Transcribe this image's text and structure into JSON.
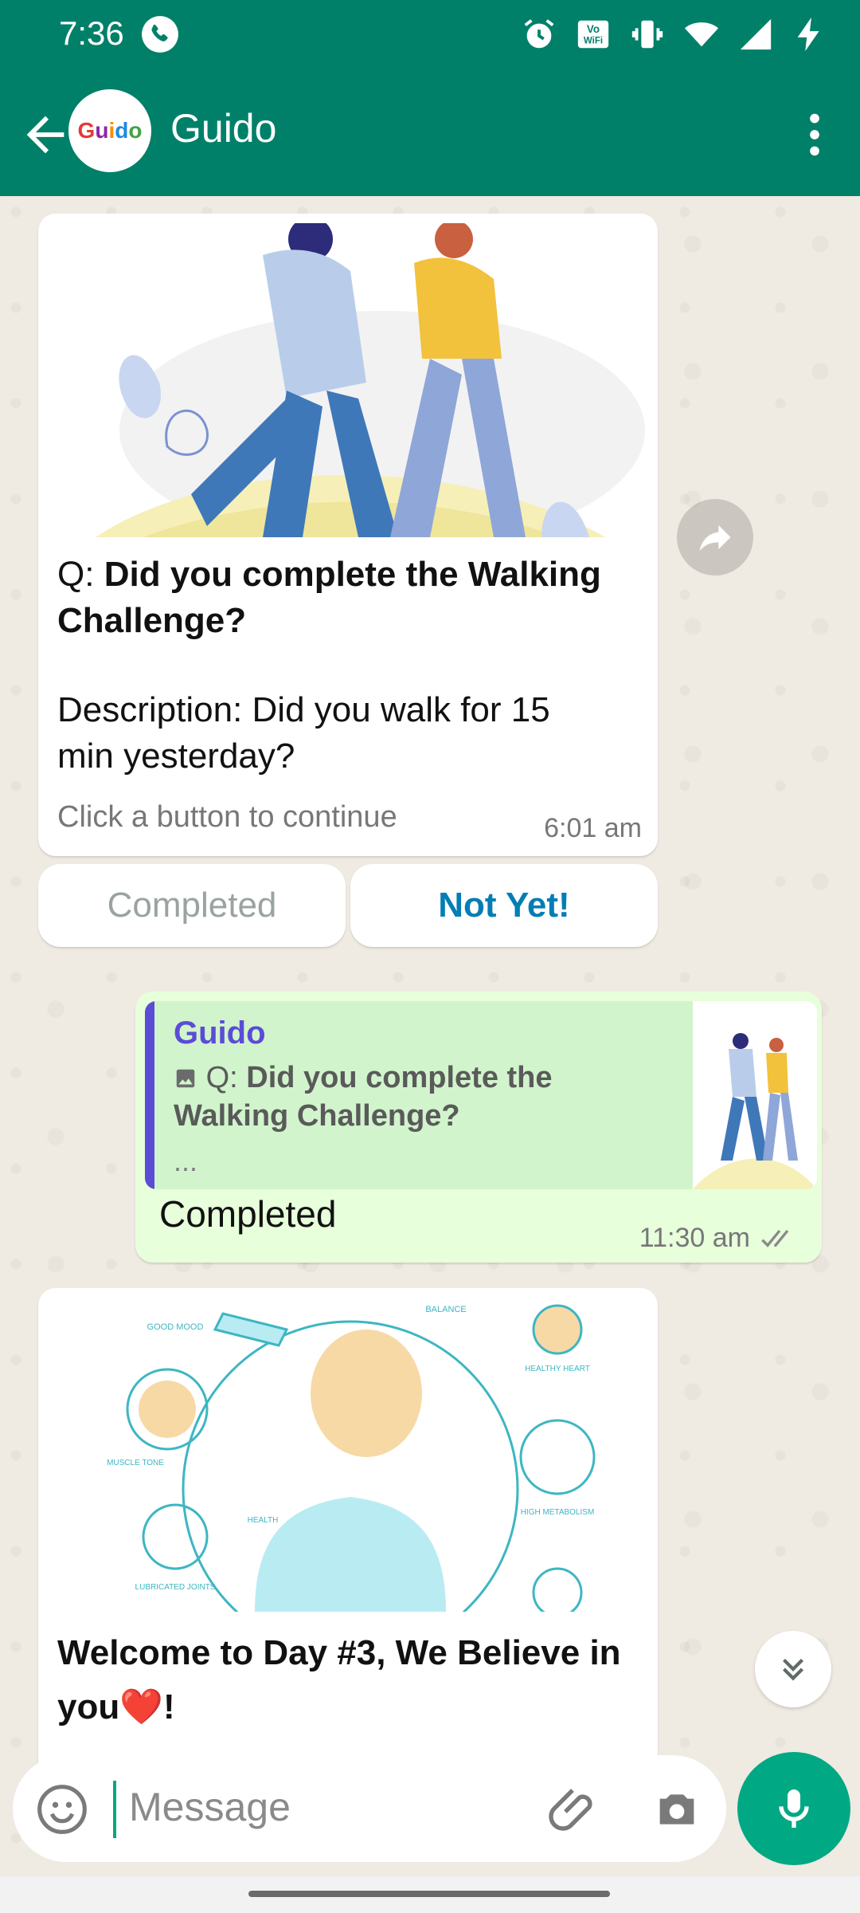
{
  "status_bar": {
    "time": "7:36",
    "icons": [
      "call-icon",
      "alarm-icon",
      "vowifi-icon",
      "vibrate-icon",
      "wifi-icon",
      "signal-icon",
      "charging-icon"
    ]
  },
  "header": {
    "avatar_text": "Guido",
    "title": "Guido"
  },
  "messages": [
    {
      "type": "incoming",
      "q_prefix": "Q: ",
      "question": "Did you complete the Walking Challenge?",
      "description": "Description: Did you walk for 15 min yesterday?",
      "hint": "Click a button to continue",
      "time": "6:01 am",
      "buttons": [
        "Completed",
        "Not Yet!"
      ]
    },
    {
      "type": "outgoing",
      "quote_author": "Guido",
      "quote_prefix": "Q: ",
      "quote_text": "Did you complete the Walking Challenge?",
      "quote_more": "...",
      "text": "Completed",
      "time": "11:30 am"
    },
    {
      "type": "incoming",
      "image_labels": [
        "GOOD MOOD",
        "BALANCE",
        "HEALTHY HEART",
        "MUSCLE TONE",
        "HEALTH",
        "HIGH METABOLISM",
        "LUBRICATED JOINTS"
      ],
      "headline": "Welcome to Day #3, We Believe in you❤️!"
    }
  ],
  "composer": {
    "placeholder": "Message"
  },
  "colors": {
    "header": "#008069",
    "outgoing_bubble": "#E7FFDB",
    "accent": "#00A884",
    "quote_bar": "#5B4CD6",
    "button_active": "#027EB5"
  }
}
